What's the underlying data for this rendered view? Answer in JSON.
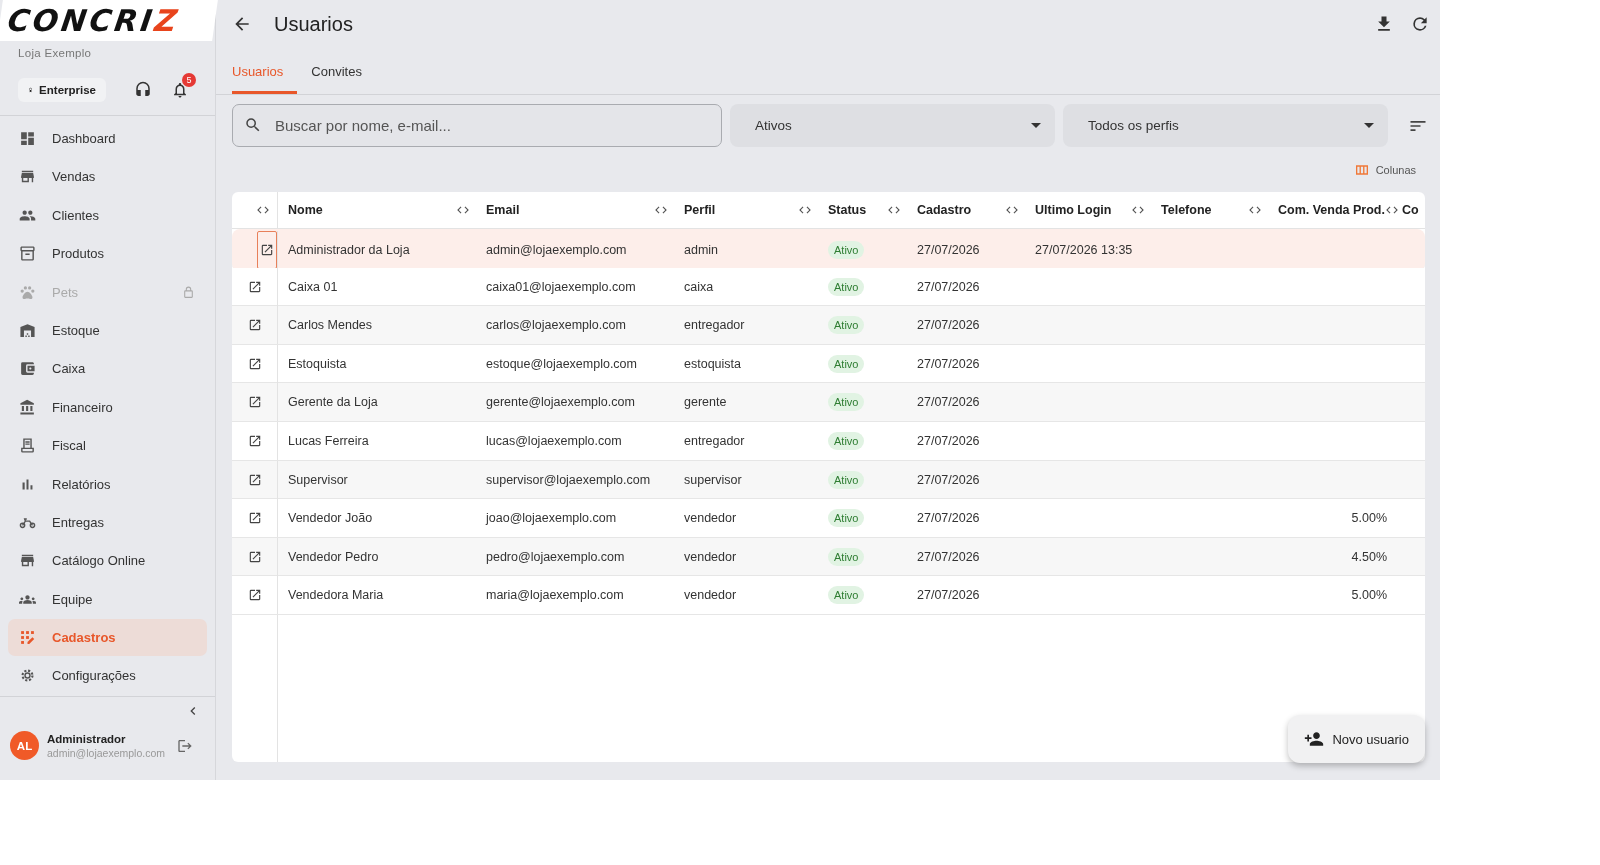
{
  "sidebar": {
    "logo": {
      "main": "CONCRI",
      "accent": "Z"
    },
    "store_name": "Loja Exemplo",
    "plan": "Enterprise",
    "notifications_count": "5",
    "nav": [
      {
        "label": "Dashboard",
        "selected": false,
        "locked": false
      },
      {
        "label": "Vendas",
        "selected": false,
        "locked": false
      },
      {
        "label": "Clientes",
        "selected": false,
        "locked": false
      },
      {
        "label": "Produtos",
        "selected": false,
        "locked": false
      },
      {
        "label": "Pets",
        "selected": false,
        "locked": true
      },
      {
        "label": "Estoque",
        "selected": false,
        "locked": false
      },
      {
        "label": "Caixa",
        "selected": false,
        "locked": false
      },
      {
        "label": "Financeiro",
        "selected": false,
        "locked": false
      },
      {
        "label": "Fiscal",
        "selected": false,
        "locked": false
      },
      {
        "label": "Relatórios",
        "selected": false,
        "locked": false
      },
      {
        "label": "Entregas",
        "selected": false,
        "locked": false
      },
      {
        "label": "Catálogo Online",
        "selected": false,
        "locked": false
      },
      {
        "label": "Equipe",
        "selected": false,
        "locked": false
      },
      {
        "label": "Cadastros",
        "selected": true,
        "locked": false
      },
      {
        "label": "Configurações",
        "selected": false,
        "locked": false
      }
    ],
    "user": {
      "initials": "AL",
      "name": "Administrador",
      "email": "admin@lojaexemplo.com"
    }
  },
  "header": {
    "title": "Usuarios"
  },
  "tabs": [
    {
      "label": "Usuarios",
      "selected": true
    },
    {
      "label": "Convites",
      "selected": false
    }
  ],
  "filters": {
    "search": {
      "placeholder": "Buscar por nome, e-mail..."
    },
    "status": "Ativos",
    "profile": "Todos os perfis"
  },
  "columns_button": "Colunas",
  "table": {
    "columns": [
      "Nome",
      "Email",
      "Perfil",
      "Status",
      "Cadastro",
      "Ultimo Login",
      "Telefone",
      "Com. Venda Prod.",
      "Co"
    ],
    "rows": [
      {
        "selected": true,
        "name": "Administrador da Loja",
        "email": "admin@lojaexemplo.com",
        "profile": "admin",
        "status": "Ativo",
        "created": "27/07/2026",
        "last_login": "27/07/2026 13:35"
      },
      {
        "selected": false,
        "name": "Caixa 01",
        "email": "caixa01@lojaexemplo.com",
        "profile": "caixa",
        "status": "Ativo",
        "created": "27/07/2026"
      },
      {
        "selected": false,
        "name": "Carlos Mendes",
        "email": "carlos@lojaexemplo.com",
        "profile": "entregador",
        "status": "Ativo",
        "created": "27/07/2026"
      },
      {
        "selected": false,
        "name": "Estoquista",
        "email": "estoque@lojaexemplo.com",
        "profile": "estoquista",
        "status": "Ativo",
        "created": "27/07/2026"
      },
      {
        "selected": false,
        "name": "Gerente da Loja",
        "email": "gerente@lojaexemplo.com",
        "profile": "gerente",
        "status": "Ativo",
        "created": "27/07/2026"
      },
      {
        "selected": false,
        "name": "Lucas Ferreira",
        "email": "lucas@lojaexemplo.com",
        "profile": "entregador",
        "status": "Ativo",
        "created": "27/07/2026"
      },
      {
        "selected": false,
        "name": "Supervisor",
        "email": "supervisor@lojaexemplo.com",
        "profile": "supervisor",
        "status": "Ativo",
        "created": "27/07/2026"
      },
      {
        "selected": false,
        "name": "Vendedor João",
        "email": "joao@lojaexemplo.com",
        "profile": "vendedor",
        "status": "Ativo",
        "created": "27/07/2026",
        "commission": "5.00%"
      },
      {
        "selected": false,
        "name": "Vendedor Pedro",
        "email": "pedro@lojaexemplo.com",
        "profile": "vendedor",
        "status": "Ativo",
        "created": "27/07/2026",
        "commission": "4.50%"
      },
      {
        "selected": false,
        "name": "Vendedora Maria",
        "email": "maria@lojaexemplo.com",
        "profile": "vendedor",
        "status": "Ativo",
        "created": "27/07/2026",
        "commission": "5.00%"
      }
    ]
  },
  "fab": "Novo usuario"
}
